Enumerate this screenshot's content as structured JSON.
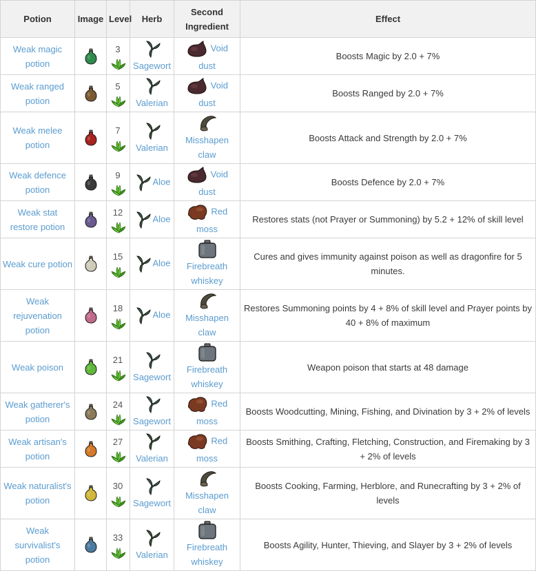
{
  "headers": {
    "potion": "Potion",
    "image": "Image",
    "level": "Level",
    "herb": "Herb",
    "second": "Second Ingredient",
    "effect": "Effect"
  },
  "rows": [
    {
      "potion": "Weak magic potion",
      "color": "#2f8a4e",
      "level": "3",
      "herb": "Sagewort",
      "herb_type": "sagewort",
      "second": "Void dust",
      "second_type": "void-dust",
      "effect": "Boosts Magic by 2.0 + 7%"
    },
    {
      "potion": "Weak ranged potion",
      "color": "#7a5a32",
      "level": "5",
      "herb": "Valerian",
      "herb_type": "valerian",
      "second": "Void dust",
      "second_type": "void-dust",
      "effect": "Boosts Ranged by 2.0 + 7%"
    },
    {
      "potion": "Weak melee potion",
      "color": "#a8231f",
      "level": "7",
      "herb": "Valerian",
      "herb_type": "valerian",
      "second": "Misshapen claw",
      "second_type": "claw",
      "effect": "Boosts Attack and Strength by 2.0 + 7%"
    },
    {
      "potion": "Weak defence potion",
      "color": "#3b3a3a",
      "level": "9",
      "herb": "Aloe",
      "herb_type": "aloe",
      "second": "Void dust",
      "second_type": "void-dust",
      "effect": "Boosts Defence by 2.0 + 7%"
    },
    {
      "potion": "Weak stat restore potion",
      "color": "#6a5a8e",
      "level": "12",
      "herb": "Aloe",
      "herb_type": "aloe",
      "second": "Red moss",
      "second_type": "red-moss",
      "effect": "Restores stats (not Prayer or Summoning) by 5.2 + 12% of skill level"
    },
    {
      "potion": "Weak cure potion",
      "color": "#cfcbb9",
      "level": "15",
      "herb": "Aloe",
      "herb_type": "aloe",
      "second": "Firebreath whiskey",
      "second_type": "whiskey",
      "effect": "Cures and gives immunity against poison as well as dragonfire for 5 minutes."
    },
    {
      "potion": "Weak rejuvenation potion",
      "color": "#c06a8c",
      "level": "18",
      "herb": "Aloe",
      "herb_type": "aloe",
      "second": "Misshapen claw",
      "second_type": "claw",
      "effect": "Restores Summoning points by 4 + 8% of skill level and Prayer points by 40 + 8% of maximum"
    },
    {
      "potion": "Weak poison",
      "color": "#5fb83a",
      "level": "21",
      "herb": "Sagewort",
      "herb_type": "sagewort",
      "second": "Firebreath whiskey",
      "second_type": "whiskey",
      "effect": "Weapon poison that starts at 48 damage"
    },
    {
      "potion": "Weak gatherer's potion",
      "color": "#8a7a5a",
      "level": "24",
      "herb": "Sagewort",
      "herb_type": "sagewort",
      "second": "Red moss",
      "second_type": "red-moss",
      "effect": "Boosts Woodcutting, Mining, Fishing, and Divination by 3 + 2% of levels"
    },
    {
      "potion": "Weak artisan's potion",
      "color": "#d47a2a",
      "level": "27",
      "herb": "Valerian",
      "herb_type": "valerian",
      "second": "Red moss",
      "second_type": "red-moss",
      "effect": "Boosts Smithing, Crafting, Fletching, Construction, and Firemaking by 3 + 2% of levels"
    },
    {
      "potion": "Weak naturalist's potion",
      "color": "#d2b83a",
      "level": "30",
      "herb": "Sagewort",
      "herb_type": "sagewort",
      "second": "Misshapen claw",
      "second_type": "claw",
      "effect": "Boosts Cooking, Farming, Herblore, and Runecrafting by 3 + 2% of levels"
    },
    {
      "potion": "Weak survivalist's potion",
      "color": "#4a7aa0",
      "level": "33",
      "herb": "Valerian",
      "herb_type": "valerian",
      "second": "Firebreath whiskey",
      "second_type": "whiskey",
      "effect": "Boosts Agility, Hunter, Thieving, and Slayer by 3 + 2% of levels"
    }
  ]
}
